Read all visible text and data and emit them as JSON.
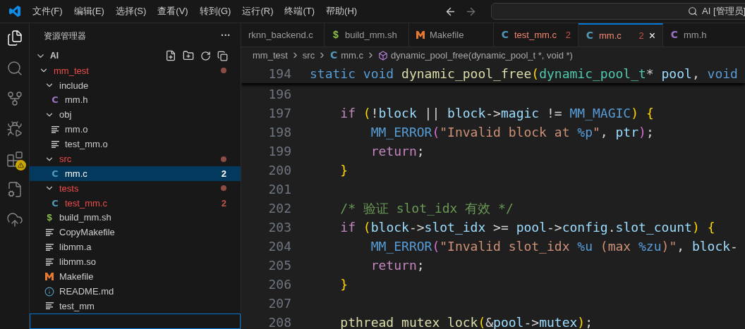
{
  "menu": [
    "文件(F)",
    "编辑(E)",
    "选择(S)",
    "查看(V)",
    "转到(G)",
    "运行(R)",
    "终端(T)",
    "帮助(H)"
  ],
  "command_center": {
    "text": "AI [管理员]"
  },
  "activity_bar": [
    {
      "selected": true
    },
    {
      "selected": false
    },
    {
      "selected": false
    },
    {
      "selected": false
    },
    {
      "selected": false,
      "warning": true
    },
    {
      "selected": false
    },
    {
      "selected": false
    }
  ],
  "explorer": {
    "title": "资源管理器",
    "more": "···",
    "root": {
      "label": "AI",
      "expanded": true,
      "children": [
        {
          "label": "mm_test",
          "expanded": true,
          "selected": false,
          "error": true,
          "modified": true,
          "children": [
            {
              "label": "include",
              "expanded": true,
              "selected": false,
              "error": false,
              "modified": false,
              "children": [
                {
                  "label": "mm.h",
                  "kind": "h",
                  "glyph": "C",
                  "selected": false,
                  "error": false
                }
              ]
            },
            {
              "label": "obj",
              "expanded": true,
              "selected": false,
              "error": false,
              "modified": false,
              "children": [
                {
                  "label": "mm.o",
                  "kind": "text",
                  "selected": false,
                  "error": false
                },
                {
                  "label": "test_mm.o",
                  "kind": "text",
                  "selected": false,
                  "error": false
                }
              ]
            },
            {
              "label": "src",
              "expanded": true,
              "selected": false,
              "error": true,
              "modified": true,
              "children": [
                {
                  "label": "mm.c",
                  "kind": "c",
                  "glyph": "C",
                  "selected": true,
                  "badge": "2"
                }
              ]
            },
            {
              "label": "tests",
              "expanded": true,
              "selected": false,
              "error": true,
              "modified": true,
              "children": [
                {
                  "label": "test_mm.c",
                  "kind": "c",
                  "glyph": "C",
                  "selected": false,
                  "error": true,
                  "badge": "2"
                }
              ]
            },
            {
              "label": "build_mm.sh",
              "kind": "sh",
              "glyph": "$",
              "selected": false,
              "error": false
            },
            {
              "label": "CopyMakefile",
              "kind": "text",
              "selected": false,
              "error": false
            },
            {
              "label": "libmm.a",
              "kind": "text",
              "selected": false,
              "error": false
            },
            {
              "label": "libmm.so",
              "kind": "text",
              "selected": false,
              "error": false
            },
            {
              "label": "Makefile",
              "kind": "make",
              "selected": false,
              "error": false
            },
            {
              "label": "README.md",
              "kind": "info",
              "selected": false,
              "error": false
            },
            {
              "label": "test_mm",
              "kind": "text",
              "selected": false,
              "error": false
            }
          ]
        }
      ]
    }
  },
  "tabs": [
    {
      "label": "rknn_backend.c",
      "selected": false,
      "error": false
    },
    {
      "label": "build_mm.sh",
      "kind": "sh",
      "glyph": "$",
      "selected": false,
      "error": false
    },
    {
      "label": "Makefile",
      "kind": "make",
      "selected": false,
      "error": false
    },
    {
      "label": "test_mm.c",
      "kind": "c",
      "glyph": "C",
      "selected": false,
      "error": true,
      "badge": "2"
    },
    {
      "label": "mm.c",
      "kind": "c",
      "glyph": "C",
      "selected": true,
      "error": true,
      "badge": "2",
      "close": "×"
    },
    {
      "label": "mm.h",
      "kind": "h",
      "glyph": "C",
      "selected": false,
      "error": false
    }
  ],
  "breadcrumb": [
    {
      "text": "mm_test"
    },
    {
      "text": "src"
    },
    {
      "text": "mm.c",
      "kind": "c",
      "glyph": "C"
    },
    {
      "text": "dynamic_pool_free(dynamic_pool_t *, void *)",
      "kind": "symbol"
    }
  ],
  "sticky_line": {
    "number": "194",
    "tokens": [
      {
        "text": "static ",
        "kind": "keyword"
      },
      {
        "text": "void ",
        "kind": "keyword"
      },
      {
        "text": "dynamic_pool_free",
        "kind": "function"
      },
      {
        "text": "(",
        "kind": "bracket1"
      },
      {
        "text": "dynamic_pool_t",
        "kind": "type"
      },
      {
        "text": "* ",
        "kind": "punct"
      },
      {
        "text": "pool",
        "kind": "variable"
      },
      {
        "text": ", ",
        "kind": "punct"
      },
      {
        "text": "void",
        "kind": "keyword"
      }
    ]
  },
  "lines": [
    {
      "number": "196"
    },
    {
      "number": "197",
      "tokens": [
        {
          "text": "    if ",
          "kind": "control"
        },
        {
          "text": "(",
          "kind": "bracket1"
        },
        {
          "text": "!",
          "kind": "punct"
        },
        {
          "text": "block",
          "kind": "variable"
        },
        {
          "text": " || ",
          "kind": "punct"
        },
        {
          "text": "block",
          "kind": "variable"
        },
        {
          "text": "->",
          "kind": "punct"
        },
        {
          "text": "magic",
          "kind": "variable"
        },
        {
          "text": " != ",
          "kind": "punct"
        },
        {
          "text": "MM_MAGIC",
          "kind": "macro"
        },
        {
          "text": ") ",
          "kind": "bracket1"
        },
        {
          "text": "{",
          "kind": "bracket1"
        }
      ]
    },
    {
      "number": "198",
      "tokens": [
        {
          "text": "        MM_ERROR",
          "kind": "macro"
        },
        {
          "text": "(",
          "kind": "bracket2"
        },
        {
          "text": "\"Invalid block at ",
          "kind": "string"
        },
        {
          "text": "%p",
          "kind": "format"
        },
        {
          "text": "\"",
          "kind": "string"
        },
        {
          "text": ", ",
          "kind": "punct"
        },
        {
          "text": "ptr",
          "kind": "variable"
        },
        {
          "text": ")",
          "kind": "bracket2"
        },
        {
          "text": ";",
          "kind": "punct"
        }
      ]
    },
    {
      "number": "199",
      "tokens": [
        {
          "text": "        return",
          "kind": "control"
        },
        {
          "text": ";",
          "kind": "punct"
        }
      ]
    },
    {
      "number": "200",
      "tokens": [
        {
          "text": "    }",
          "kind": "bracket1"
        }
      ]
    },
    {
      "number": "201"
    },
    {
      "number": "202",
      "tokens": [
        {
          "text": "    /* 验证 slot_idx 有效 */",
          "kind": "comment"
        }
      ]
    },
    {
      "number": "203",
      "tokens": [
        {
          "text": "    if ",
          "kind": "control"
        },
        {
          "text": "(",
          "kind": "bracket1"
        },
        {
          "text": "block",
          "kind": "variable"
        },
        {
          "text": "->",
          "kind": "punct"
        },
        {
          "text": "slot_idx",
          "kind": "variable"
        },
        {
          "text": " >= ",
          "kind": "punct"
        },
        {
          "text": "pool",
          "kind": "variable"
        },
        {
          "text": "->",
          "kind": "punct"
        },
        {
          "text": "config",
          "kind": "variable"
        },
        {
          "text": ".",
          "kind": "punct"
        },
        {
          "text": "slot_count",
          "kind": "variable"
        },
        {
          "text": ") ",
          "kind": "bracket1"
        },
        {
          "text": "{",
          "kind": "bracket1"
        }
      ]
    },
    {
      "number": "204",
      "tokens": [
        {
          "text": "        MM_ERROR",
          "kind": "macro"
        },
        {
          "text": "(",
          "kind": "bracket2"
        },
        {
          "text": "\"Invalid slot_idx ",
          "kind": "string"
        },
        {
          "text": "%u",
          "kind": "format"
        },
        {
          "text": " (max ",
          "kind": "string"
        },
        {
          "text": "%zu",
          "kind": "format"
        },
        {
          "text": ")\"",
          "kind": "string"
        },
        {
          "text": ", ",
          "kind": "punct"
        },
        {
          "text": "block",
          "kind": "variable"
        },
        {
          "text": "-",
          "kind": "punct"
        }
      ]
    },
    {
      "number": "205",
      "tokens": [
        {
          "text": "        return",
          "kind": "control"
        },
        {
          "text": ";",
          "kind": "punct"
        }
      ]
    },
    {
      "number": "206",
      "tokens": [
        {
          "text": "    }",
          "kind": "bracket1"
        }
      ]
    },
    {
      "number": "207"
    },
    {
      "number": "208",
      "tokens": [
        {
          "text": "    pthread_mutex_lock",
          "kind": "function"
        },
        {
          "text": "(",
          "kind": "bracket1"
        },
        {
          "text": "&",
          "kind": "punct"
        },
        {
          "text": "pool",
          "kind": "variable"
        },
        {
          "text": "->",
          "kind": "punct"
        },
        {
          "text": "mutex",
          "kind": "variable"
        },
        {
          "text": ")",
          "kind": "bracket1"
        },
        {
          "text": ";",
          "kind": "punct"
        }
      ]
    }
  ]
}
